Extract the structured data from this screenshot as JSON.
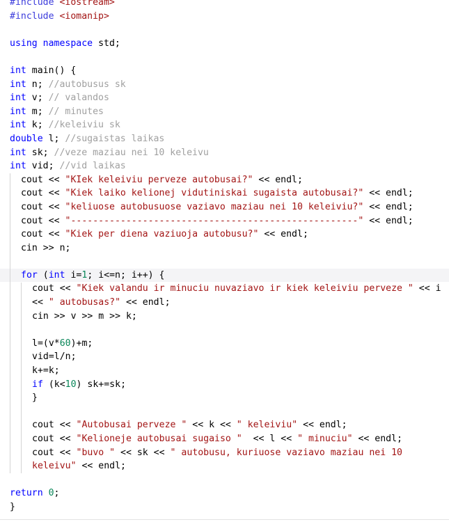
{
  "editor": {
    "language": "C++",
    "current_line": 21,
    "lines": [
      {
        "indent": 0,
        "tokens": [
          {
            "t": "pp",
            "v": "#include "
          },
          {
            "t": "str",
            "v": "<iostream>"
          }
        ]
      },
      {
        "indent": 0,
        "tokens": [
          {
            "t": "pp",
            "v": "#include "
          },
          {
            "t": "str",
            "v": "<iomanip>"
          }
        ]
      },
      {
        "indent": 0,
        "tokens": []
      },
      {
        "indent": 0,
        "tokens": [
          {
            "t": "kw",
            "v": "using"
          },
          {
            "t": "op",
            "v": " "
          },
          {
            "t": "kw",
            "v": "namespace"
          },
          {
            "t": "op",
            "v": " std;"
          }
        ]
      },
      {
        "indent": 0,
        "tokens": []
      },
      {
        "indent": 0,
        "tokens": [
          {
            "t": "kw",
            "v": "int"
          },
          {
            "t": "op",
            "v": " main() {"
          }
        ]
      },
      {
        "indent": 0,
        "tokens": [
          {
            "t": "kw",
            "v": "int"
          },
          {
            "t": "op",
            "v": " n; "
          },
          {
            "t": "cm",
            "v": "//autobusus sk"
          }
        ]
      },
      {
        "indent": 0,
        "tokens": [
          {
            "t": "kw",
            "v": "int"
          },
          {
            "t": "op",
            "v": " v; "
          },
          {
            "t": "cm",
            "v": "// valandos"
          }
        ]
      },
      {
        "indent": 0,
        "tokens": [
          {
            "t": "kw",
            "v": "int"
          },
          {
            "t": "op",
            "v": " m; "
          },
          {
            "t": "cm",
            "v": "// minutes"
          }
        ]
      },
      {
        "indent": 0,
        "tokens": [
          {
            "t": "kw",
            "v": "int"
          },
          {
            "t": "op",
            "v": " k; "
          },
          {
            "t": "cm",
            "v": "//keleiviu sk"
          }
        ]
      },
      {
        "indent": 0,
        "tokens": [
          {
            "t": "kw",
            "v": "double"
          },
          {
            "t": "op",
            "v": " l; "
          },
          {
            "t": "cm",
            "v": "//sugaistas laikas"
          }
        ]
      },
      {
        "indent": 0,
        "tokens": [
          {
            "t": "kw",
            "v": "int"
          },
          {
            "t": "op",
            "v": " sk; "
          },
          {
            "t": "cm",
            "v": "//veze maziau nei 10 keleivu"
          }
        ]
      },
      {
        "indent": 0,
        "tokens": [
          {
            "t": "kw",
            "v": "int"
          },
          {
            "t": "op",
            "v": " vid; "
          },
          {
            "t": "cm",
            "v": "//vid laikas"
          }
        ]
      },
      {
        "indent": 1,
        "tokens": [
          {
            "t": "op",
            "v": "cout << "
          },
          {
            "t": "str",
            "v": "\"KIek keleiviu perveze autobusai?\""
          },
          {
            "t": "op",
            "v": " << endl;"
          }
        ]
      },
      {
        "indent": 1,
        "tokens": [
          {
            "t": "op",
            "v": "cout << "
          },
          {
            "t": "str",
            "v": "\"Kiek laiko kelionej vidutiniskai sugaista autobusai?\""
          },
          {
            "t": "op",
            "v": " << endl;"
          }
        ]
      },
      {
        "indent": 1,
        "tokens": [
          {
            "t": "op",
            "v": "cout << "
          },
          {
            "t": "str",
            "v": "\"keliuose autobusuose vaziavo maziau nei 10 keleiviu?\""
          },
          {
            "t": "op",
            "v": " << endl;"
          }
        ]
      },
      {
        "indent": 1,
        "tokens": [
          {
            "t": "op",
            "v": "cout << "
          },
          {
            "t": "str",
            "v": "\"----------------------------------------------------\""
          },
          {
            "t": "op",
            "v": " << endl;"
          }
        ]
      },
      {
        "indent": 1,
        "tokens": [
          {
            "t": "op",
            "v": "cout << "
          },
          {
            "t": "str",
            "v": "\"Kiek per diena vaziuoja autobusu?\""
          },
          {
            "t": "op",
            "v": " << endl;"
          }
        ]
      },
      {
        "indent": 1,
        "tokens": [
          {
            "t": "op",
            "v": "cin >> n;"
          }
        ]
      },
      {
        "indent": 1,
        "tokens": []
      },
      {
        "indent": 1,
        "tokens": [
          {
            "t": "kw",
            "v": "for"
          },
          {
            "t": "op",
            "v": " ("
          },
          {
            "t": "kw",
            "v": "int"
          },
          {
            "t": "op",
            "v": " i="
          },
          {
            "t": "num",
            "v": "1"
          },
          {
            "t": "op",
            "v": "; i<=n; i++) {"
          }
        ]
      },
      {
        "indent": 2,
        "tokens": [
          {
            "t": "op",
            "v": "cout << "
          },
          {
            "t": "str",
            "v": "\"Kiek valandu ir minuciu nuvaziavo ir kiek keleiviu perveze \""
          },
          {
            "t": "op",
            "v": " << i"
          }
        ]
      },
      {
        "indent": 2,
        "tokens": [
          {
            "t": "op",
            "v": "<< "
          },
          {
            "t": "str",
            "v": "\" autobusas?\""
          },
          {
            "t": "op",
            "v": " << endl;"
          }
        ]
      },
      {
        "indent": 2,
        "tokens": [
          {
            "t": "op",
            "v": "cin >> v >> m >> k;"
          }
        ]
      },
      {
        "indent": 2,
        "tokens": []
      },
      {
        "indent": 2,
        "tokens": [
          {
            "t": "op",
            "v": "l=(v*"
          },
          {
            "t": "num",
            "v": "60"
          },
          {
            "t": "op",
            "v": ")+m;"
          }
        ]
      },
      {
        "indent": 2,
        "tokens": [
          {
            "t": "op",
            "v": "vid=l/n;"
          }
        ]
      },
      {
        "indent": 2,
        "tokens": [
          {
            "t": "op",
            "v": "k+=k;"
          }
        ]
      },
      {
        "indent": 2,
        "tokens": [
          {
            "t": "kw",
            "v": "if"
          },
          {
            "t": "op",
            "v": " (k<"
          },
          {
            "t": "num",
            "v": "10"
          },
          {
            "t": "op",
            "v": ") sk+=sk;"
          }
        ]
      },
      {
        "indent": 2,
        "tokens": [
          {
            "t": "op",
            "v": "}"
          }
        ]
      },
      {
        "indent": 2,
        "tokens": []
      },
      {
        "indent": 2,
        "tokens": [
          {
            "t": "op",
            "v": "cout << "
          },
          {
            "t": "str",
            "v": "\"Autobusai perveze \""
          },
          {
            "t": "op",
            "v": " << k << "
          },
          {
            "t": "str",
            "v": "\" keleiviu\""
          },
          {
            "t": "op",
            "v": " << endl;"
          }
        ]
      },
      {
        "indent": 2,
        "tokens": [
          {
            "t": "op",
            "v": "cout << "
          },
          {
            "t": "str",
            "v": "\"Kelioneje autobusai sugaiso \""
          },
          {
            "t": "op",
            "v": "  << l << "
          },
          {
            "t": "str",
            "v": "\" minuciu\""
          },
          {
            "t": "op",
            "v": " << endl;"
          }
        ]
      },
      {
        "indent": 2,
        "tokens": [
          {
            "t": "op",
            "v": "cout << "
          },
          {
            "t": "str",
            "v": "\"buvo \""
          },
          {
            "t": "op",
            "v": " << sk << "
          },
          {
            "t": "str",
            "v": "\" autobusu, kuriuose vaziavo maziau nei 10"
          }
        ]
      },
      {
        "indent": 2,
        "tokens": [
          {
            "t": "str",
            "v": "keleivu\""
          },
          {
            "t": "op",
            "v": " << endl;"
          }
        ]
      },
      {
        "indent": 0,
        "tokens": []
      },
      {
        "indent": 0,
        "tokens": [
          {
            "t": "kw",
            "v": "return"
          },
          {
            "t": "op",
            "v": " "
          },
          {
            "t": "num",
            "v": "0"
          },
          {
            "t": "op",
            "v": ";"
          }
        ]
      },
      {
        "indent": 0,
        "tokens": [
          {
            "t": "op",
            "v": "}"
          }
        ]
      }
    ]
  }
}
